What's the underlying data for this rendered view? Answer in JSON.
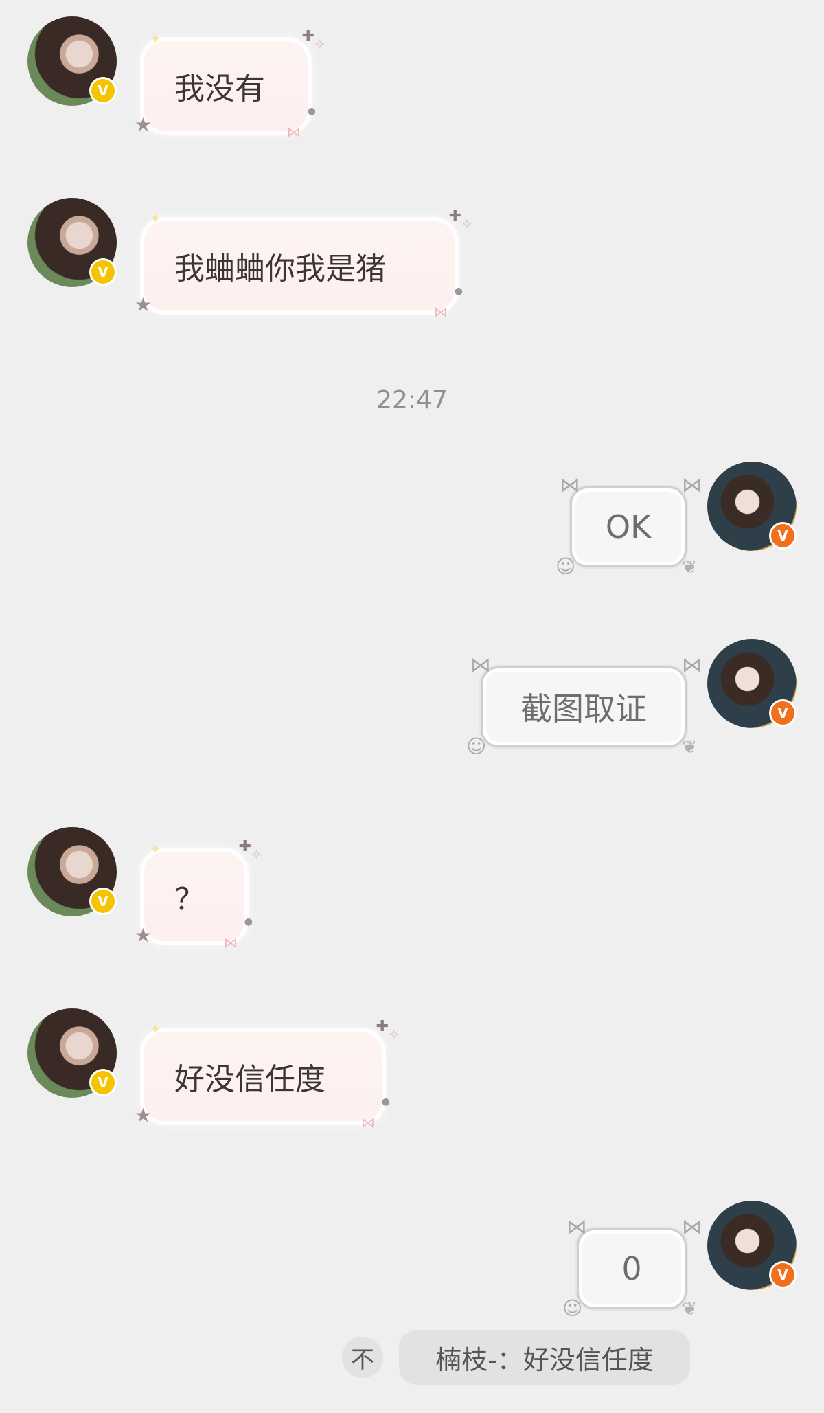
{
  "messages": [
    {
      "side": "left",
      "text": "我没有"
    },
    {
      "side": "left",
      "text": "我蛐蛐你我是猪"
    },
    {
      "side": "right",
      "text": "OK"
    },
    {
      "side": "right",
      "text": "截图取证"
    },
    {
      "side": "left",
      "text": "？"
    },
    {
      "side": "left",
      "text": "好没信任度"
    },
    {
      "side": "right",
      "text": "0"
    }
  ],
  "timestamp": "22:47",
  "verified_badge": "V",
  "quote": {
    "icon": "不",
    "text": "楠枝-：好没信任度"
  },
  "colors": {
    "background": "#efefef",
    "left_bubble": "#fdf4f2",
    "right_bubble": "#f6f6f6",
    "badge_yellow": "#f5c400",
    "badge_orange": "#f0701e"
  }
}
